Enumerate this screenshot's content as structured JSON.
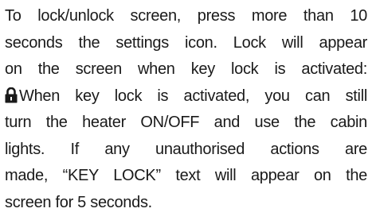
{
  "paragraph": {
    "line1": "To lock/unlock screen, press more than 10",
    "line2": "seconds the settings icon. Lock will appear",
    "line3": "on the screen when key lock is activated:",
    "line4_text": "When key lock is activated, you can still",
    "line5": "turn the heater ON/OFF and use the cabin",
    "line6": "lights. If any unauthorised actions are",
    "line7": "made, “KEY LOCK” text will appear on the",
    "line8": "screen for 5 seconds."
  },
  "icons": {
    "inline_icon": "lock-icon"
  },
  "colors": {
    "text": "#1a1a1a",
    "background": "#ffffff"
  }
}
